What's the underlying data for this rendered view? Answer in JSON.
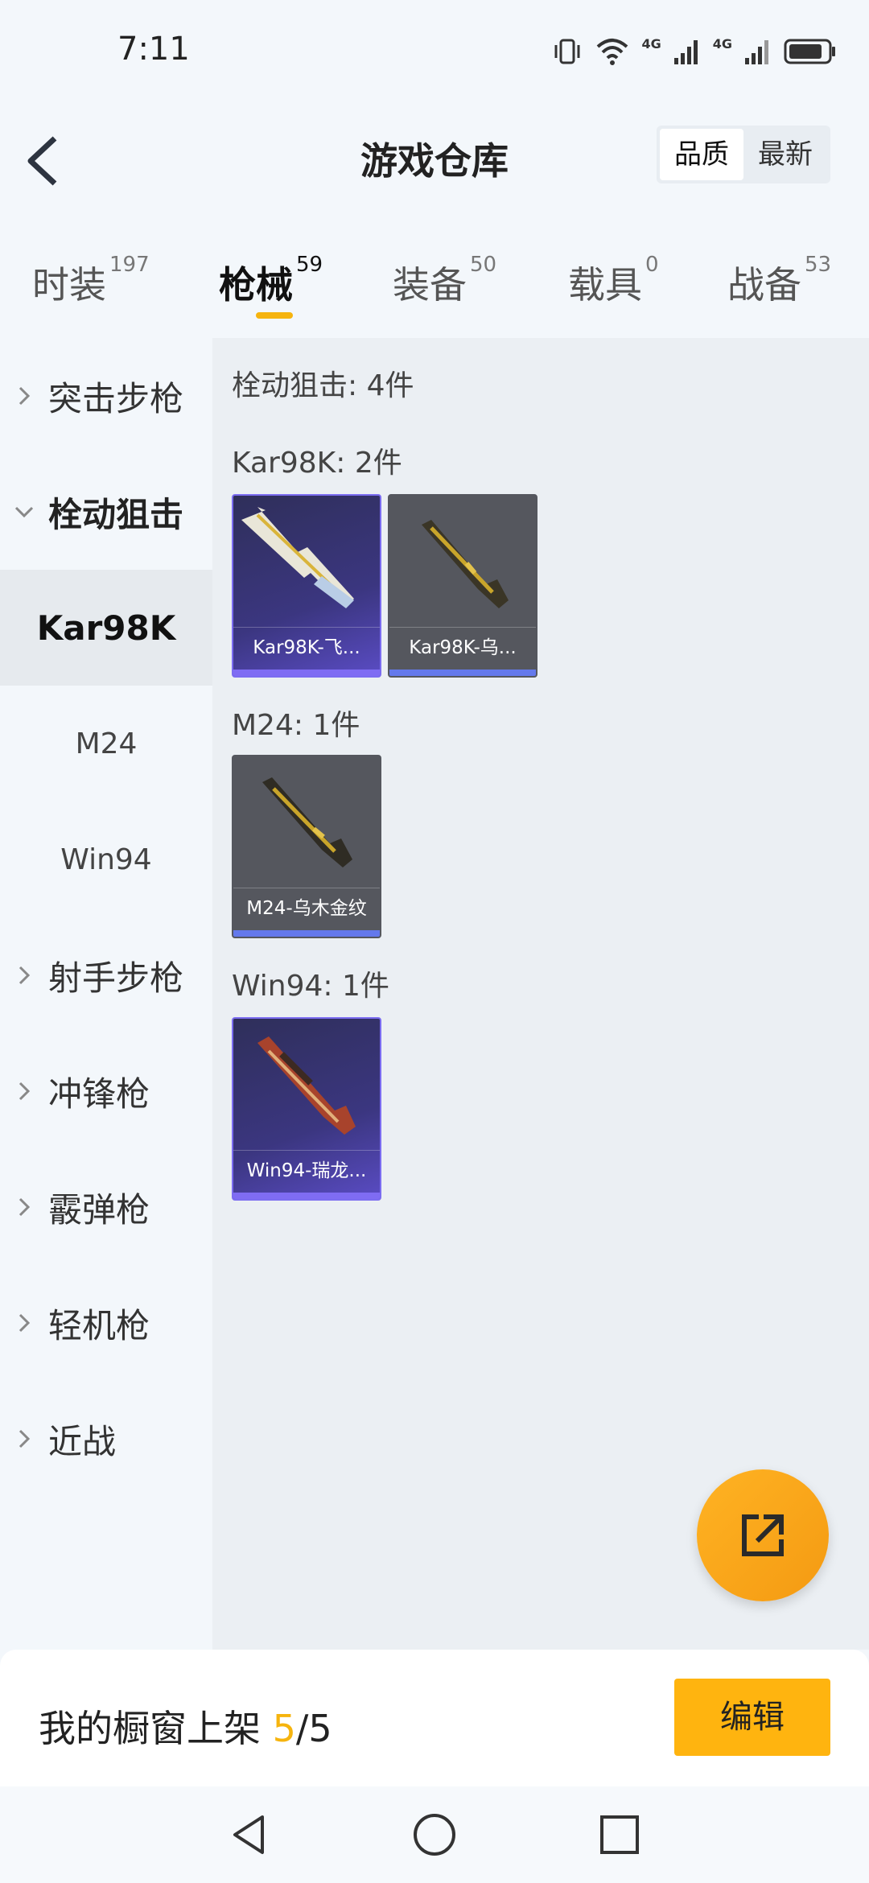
{
  "status_bar": {
    "time": "7:11",
    "network_labels": [
      "4G",
      "4G"
    ]
  },
  "header": {
    "title": "游戏仓库",
    "sort_options": [
      "品质",
      "最新"
    ]
  },
  "tabs": [
    {
      "label": "时装",
      "count": "197"
    },
    {
      "label": "枪械",
      "count": "59"
    },
    {
      "label": "装备",
      "count": "50"
    },
    {
      "label": "载具",
      "count": "0"
    },
    {
      "label": "战备",
      "count": "53"
    }
  ],
  "sidebar": {
    "categories": [
      {
        "label": "突击步枪"
      },
      {
        "label": "栓动狙击"
      },
      {
        "label": "射手步枪"
      },
      {
        "label": "冲锋枪"
      },
      {
        "label": "霰弹枪"
      },
      {
        "label": "轻机枪"
      },
      {
        "label": "近战"
      }
    ],
    "subitems": [
      "Kar98K",
      "M24",
      "Win94"
    ]
  },
  "content": {
    "summary": "栓动狙击: 4件",
    "groups": [
      {
        "title": "Kar98K: 2件",
        "items": [
          {
            "name": "Kar98K-飞..."
          },
          {
            "name": "Kar98K-乌..."
          }
        ]
      },
      {
        "title": "M24: 1件",
        "items": [
          {
            "name": "M24-乌木金纹"
          }
        ]
      },
      {
        "title": "Win94: 1件",
        "items": [
          {
            "name": "Win94-瑞龙..."
          }
        ]
      }
    ]
  },
  "bottom": {
    "showcase_label": "我的橱窗上架",
    "count_current": "5",
    "count_total": "/5",
    "edit_label": "编辑"
  },
  "colors": {
    "accent": "#f6b40e",
    "rare_purple": "#7b6cf0",
    "blue_bar": "#6479ec"
  }
}
